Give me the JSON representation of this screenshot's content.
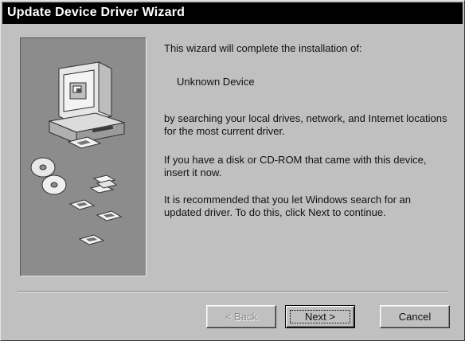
{
  "window": {
    "title": "Update Device Driver Wizard"
  },
  "content": {
    "intro": "This wizard will complete the installation of:",
    "device_name": "Unknown Device",
    "search_text": "by searching your local drives, network, and Internet locations for the most current driver.",
    "disk_text": "If you have a disk or CD-ROM that came with this device, insert it now.",
    "recommend_text": "It is recommended that you let Windows search for an updated driver. To do this, click Next to continue."
  },
  "buttons": {
    "back_label": "< Back",
    "next_label": "Next >",
    "cancel_label": "Cancel"
  },
  "icons": {
    "illustration": "computer-with-disks-illustration"
  }
}
